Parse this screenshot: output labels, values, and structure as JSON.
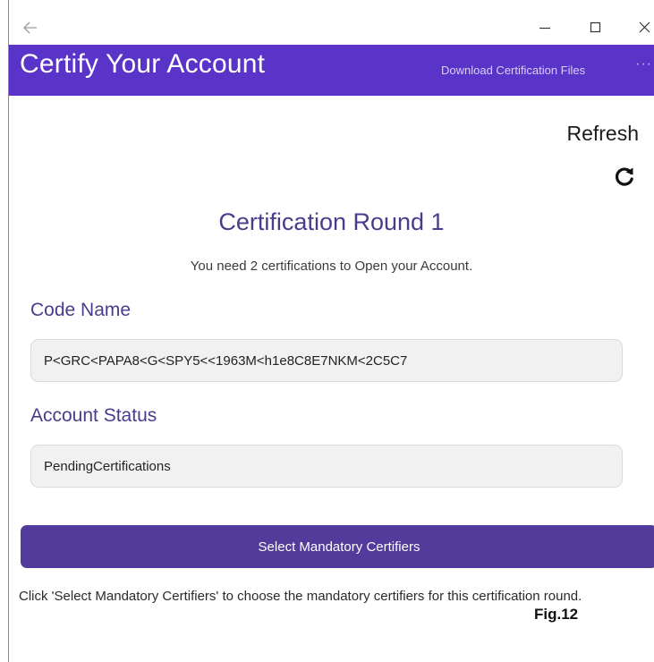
{
  "window": {
    "back_icon": "arrow-left-icon",
    "minimize_icon": "minimize-icon",
    "maximize_icon": "maximize-icon",
    "close_icon": "close-icon"
  },
  "appbar": {
    "title": "Certify Your Account",
    "download_link": "Download Certification Files",
    "more_label": "···",
    "color": "#5a34c8"
  },
  "refresh": {
    "label": "Refresh",
    "icon": "refresh-icon"
  },
  "round": {
    "title": "Certification Round 1",
    "info": "You need 2 certifications to Open your Account."
  },
  "code_name": {
    "label": "Code Name",
    "value": "P<GRC<PAPA8<G<SPY5<<1963M<h1e8C8E7NKM<2C5C7"
  },
  "account_status": {
    "label": "Account Status",
    "value": "PendingCertifications"
  },
  "actions": {
    "select_certifiers_label": "Select Mandatory Certifiers",
    "button_color": "#523b9a"
  },
  "hint": "Click 'Select Mandatory Certifiers' to choose the mandatory certifiers for this certification round.",
  "figure_label": "Fig.12"
}
